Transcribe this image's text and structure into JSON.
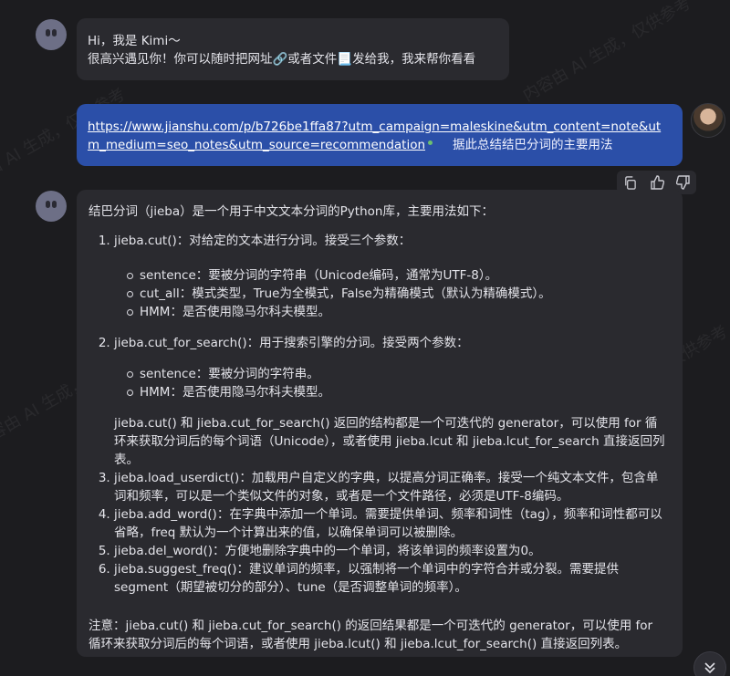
{
  "greeting": {
    "line1": "Hi，我是 Kimi～",
    "line2": "很高兴遇见你！你可以随时把网址🔗或者文件📃发给我，我来帮你看看"
  },
  "user_message": {
    "url": "https://www.jianshu.com/p/b726be1ffa87?utm_campaign=maleskine&utm_content=note&utm_medium=seo_notes&utm_source=recommendation",
    "text": "据此总结结巴分词的主要用法"
  },
  "actions": {
    "copy_icon": "copy-icon",
    "like_icon": "thumbs-up-icon",
    "dislike_icon": "thumbs-down-icon"
  },
  "answer": {
    "intro": "结巴分词（jieba）是一个用于中文文本分词的Python库，主要用法如下：",
    "items": [
      {
        "title": "jieba.cut()：对给定的文本进行分词。接受三个参数：",
        "bullets": [
          "sentence：要被分词的字符串（Unicode编码，通常为UTF-8）。",
          "cut_all：模式类型，True为全模式，False为精确模式（默认为精确模式）。",
          "HMM：是否使用隐马尔科夫模型。"
        ]
      },
      {
        "title": "jieba.cut_for_search()：用于搜索引擎的分词。接受两个参数：",
        "bullets": [
          "sentence：要被分词的字符串。",
          "HMM：是否使用隐马尔科夫模型。"
        ],
        "note": "jieba.cut() 和 jieba.cut_for_search() 返回的结构都是一个可迭代的 generator，可以使用 for 循环来获取分词后的每个词语（Unicode），或者使用 jieba.lcut 和 jieba.lcut_for_search 直接返回列表。"
      },
      {
        "title": "jieba.load_userdict()：加载用户自定义的字典，以提高分词正确率。接受一个纯文本文件，包含单词和频率，可以是一个类似文件的对象，或者是一个文件路径，必须是UTF-8编码。"
      },
      {
        "title": "jieba.add_word()：在字典中添加一个单词。需要提供单词、频率和词性（tag），频率和词性都可以省略，freq 默认为一个计算出来的值，以确保单词可以被删除。"
      },
      {
        "title": "jieba.del_word()：方便地删除字典中的一个单词，将该单词的频率设置为0。"
      },
      {
        "title": "jieba.suggest_freq()：建议单词的频率，以强制将一个单词中的字符合并或分裂。需要提供 segment（期望被切分的部分）、tune（是否调整单词的频率）。"
      }
    ],
    "footer": "注意：jieba.cut() 和 jieba.cut_for_search() 的返回结果都是一个可迭代的 generator，可以使用 for 循环来获取分词后的每个词语，或者使用 jieba.lcut() 和 jieba.lcut_for_search() 直接返回列表。"
  },
  "watermark": "内容由 AI 生成，仅供参考"
}
